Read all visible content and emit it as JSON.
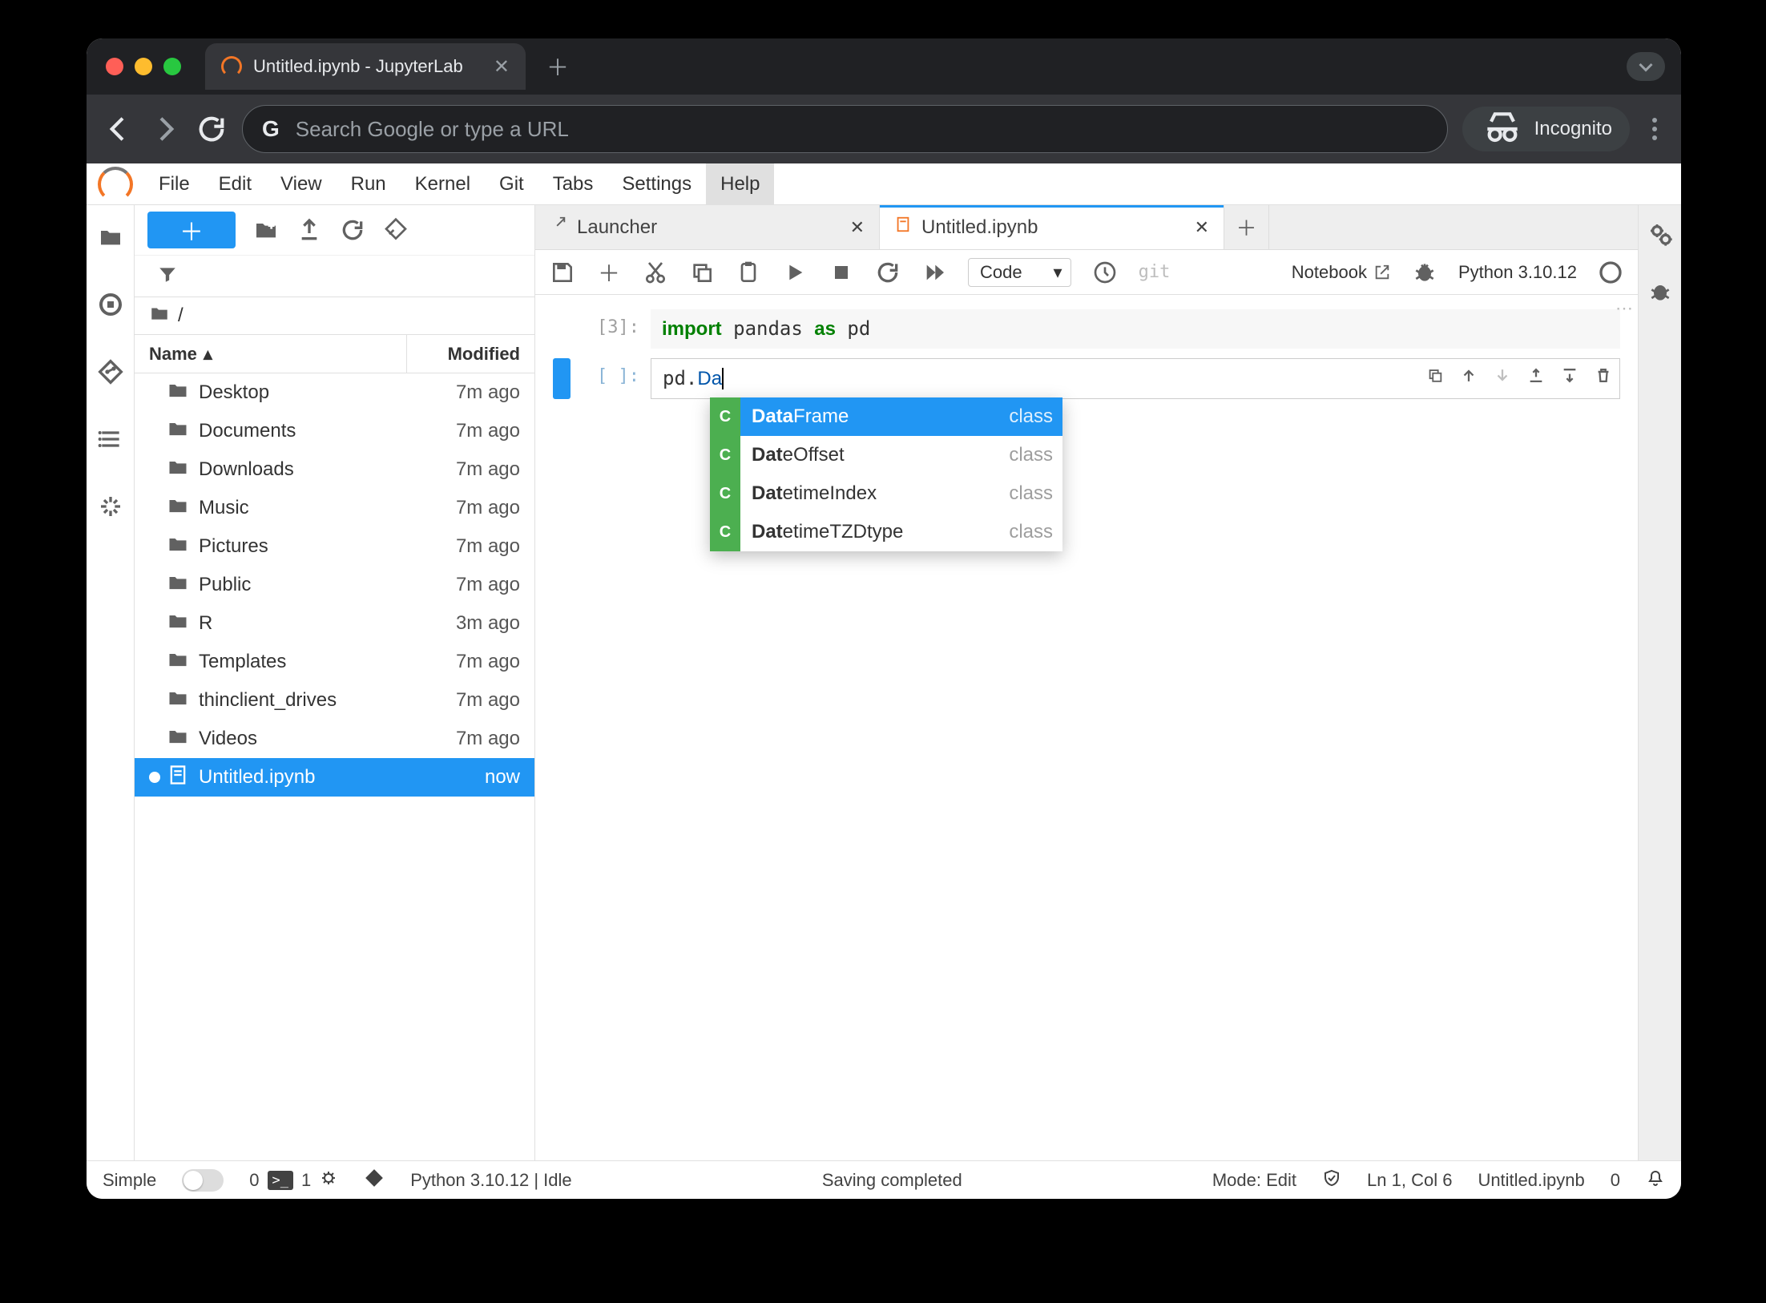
{
  "browser": {
    "tab_title": "Untitled.ipynb - JupyterLab",
    "omnibox_placeholder": "Search Google or type a URL",
    "incognito_label": "Incognito"
  },
  "menubar": [
    "File",
    "Edit",
    "View",
    "Run",
    "Kernel",
    "Git",
    "Tabs",
    "Settings",
    "Help"
  ],
  "menubar_hover_index": 8,
  "filebrowser": {
    "breadcrumb": "/",
    "header_name": "Name",
    "header_mod": "Modified",
    "items": [
      {
        "type": "folder",
        "name": "Desktop",
        "mod": "7m ago"
      },
      {
        "type": "folder",
        "name": "Documents",
        "mod": "7m ago"
      },
      {
        "type": "folder",
        "name": "Downloads",
        "mod": "7m ago"
      },
      {
        "type": "folder",
        "name": "Music",
        "mod": "7m ago"
      },
      {
        "type": "folder",
        "name": "Pictures",
        "mod": "7m ago"
      },
      {
        "type": "folder",
        "name": "Public",
        "mod": "7m ago"
      },
      {
        "type": "folder",
        "name": "R",
        "mod": "3m ago"
      },
      {
        "type": "folder",
        "name": "Templates",
        "mod": "7m ago"
      },
      {
        "type": "folder",
        "name": "thinclient_drives",
        "mod": "7m ago"
      },
      {
        "type": "folder",
        "name": "Videos",
        "mod": "7m ago"
      },
      {
        "type": "notebook",
        "name": "Untitled.ipynb",
        "mod": "now",
        "selected": true,
        "dirty": true
      }
    ]
  },
  "doc_tabs": [
    {
      "label": "Launcher",
      "icon": "launcher"
    },
    {
      "label": "Untitled.ipynb",
      "icon": "notebook",
      "active": true
    }
  ],
  "nb_toolbar": {
    "cell_type": "Code",
    "git_label": "git",
    "trusted_label": "Notebook",
    "kernel_label": "Python 3.10.12"
  },
  "cells": [
    {
      "prompt": "[3]:",
      "code_html": "<span class='kw'>import</span> pandas <span class='kw'>as</span> pd"
    },
    {
      "prompt": "[ ]:",
      "code_html": "pd.<span class='typed'>Da</span>",
      "active": true,
      "toolbar": true
    }
  ],
  "completion": {
    "badge": "C",
    "kind_label": "class",
    "items": [
      {
        "match": "Data",
        "rest": "Frame",
        "selected": true
      },
      {
        "match": "Dat",
        "rest": "eOffset"
      },
      {
        "match": "Dat",
        "rest": "etimeIndex"
      },
      {
        "match": "Dat",
        "rest": "etimeTZDtype"
      }
    ]
  },
  "status": {
    "simple": "Simple",
    "tabs_count": "0",
    "terminals": "1",
    "kernel": "Python 3.10.12 | Idle",
    "save": "Saving completed",
    "mode": "Mode: Edit",
    "cursor": "Ln 1, Col 6",
    "doc": "Untitled.ipynb",
    "notif": "0"
  }
}
